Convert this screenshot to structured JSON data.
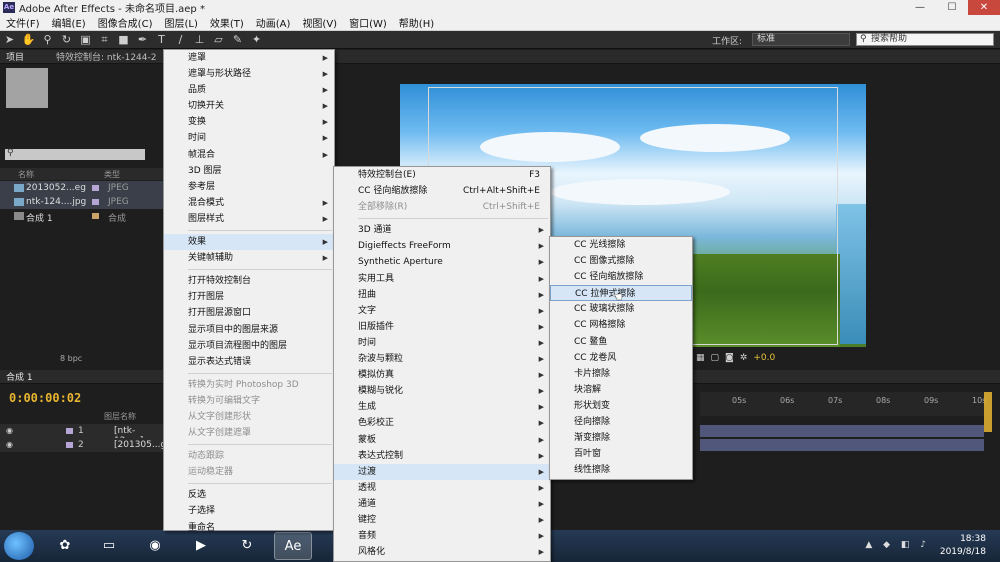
{
  "window": {
    "title": "Adobe After Effects - 未命名项目.aep *",
    "logo": "Ae"
  },
  "menubar": [
    "文件(F)",
    "编辑(E)",
    "图像合成(C)",
    "图层(L)",
    "效果(T)",
    "动画(A)",
    "视图(V)",
    "窗口(W)",
    "帮助(H)"
  ],
  "toolbar": {
    "workspace_label": "工作区:",
    "workspace_value": "标准",
    "help_placeholder": "搜索帮助"
  },
  "panels": {
    "project_tab": "项目",
    "effect_controls_tab": "特效控制台: ntk-1244-2",
    "comp_tab_fragment": "成 1",
    "project_header_name": "名称",
    "project_header_type": "类型",
    "project_items": [
      {
        "name": "2013052...eg",
        "type": "JPEG"
      },
      {
        "name": "ntk-124....jpg",
        "type": "JPEG"
      },
      {
        "name": "合成 1",
        "type": "合成"
      }
    ],
    "bpc": "8 bpc",
    "viewer_offset": "+0.0"
  },
  "timeline": {
    "tab": "合成 1",
    "timecode": "0:00:00:02",
    "header_name": "图层名称",
    "layers": [
      {
        "num": "1",
        "name": "[ntk-12...g]"
      },
      {
        "num": "2",
        "name": "[201305...g]"
      }
    ],
    "ruler": [
      "05s",
      "06s",
      "07s",
      "08s",
      "09s",
      "10s"
    ]
  },
  "layer_menu": {
    "items": [
      {
        "label": "遮罩",
        "sub": true
      },
      {
        "label": "遮罩与形状路径",
        "sub": true
      },
      {
        "label": "品质",
        "sub": true
      },
      {
        "label": "切换开关",
        "sub": true
      },
      {
        "label": "变换",
        "sub": true
      },
      {
        "label": "时间",
        "sub": true
      },
      {
        "label": "帧混合",
        "sub": true
      },
      {
        "label": "3D 图层",
        "sub": false
      },
      {
        "label": "参考层",
        "sub": false
      },
      {
        "label": "混合模式",
        "sub": true
      },
      {
        "label": "图层样式",
        "sub": true
      },
      {
        "sep": true
      },
      {
        "label": "效果",
        "sub": true,
        "hi": true
      },
      {
        "label": "关键帧辅助",
        "sub": true
      },
      {
        "sep": true
      },
      {
        "label": "打开特效控制台",
        "sub": false
      },
      {
        "label": "打开图层",
        "sub": false
      },
      {
        "label": "打开图层源窗口",
        "sub": false
      },
      {
        "label": "显示项目中的图层来源",
        "sub": false
      },
      {
        "label": "显示项目流程图中的图层",
        "sub": false
      },
      {
        "label": "显示表达式错误",
        "sub": false
      },
      {
        "sep": true
      },
      {
        "label": "转换为实时 Photoshop 3D",
        "dis": true
      },
      {
        "label": "转换为可编辑文字",
        "dis": true
      },
      {
        "label": "从文字创建形状",
        "dis": true
      },
      {
        "label": "从文字创建遮罩",
        "dis": true
      },
      {
        "sep": true
      },
      {
        "label": "动态跟踪",
        "dis": true
      },
      {
        "label": "运动稳定器",
        "dis": true
      },
      {
        "sep": true
      },
      {
        "label": "反选",
        "sub": false
      },
      {
        "label": "子选择",
        "sub": false
      },
      {
        "label": "重命名",
        "sub": false
      }
    ]
  },
  "effect_menu": {
    "items": [
      {
        "label": "特效控制台(E)",
        "shortcut": "F3"
      },
      {
        "label": "CC 径向缩放擦除",
        "shortcut": "Ctrl+Alt+Shift+E"
      },
      {
        "label": "全部移除(R)",
        "shortcut": "Ctrl+Shift+E",
        "dis": true
      },
      {
        "sep": true
      },
      {
        "label": "3D 通道",
        "sub": true
      },
      {
        "label": "Digieffects FreeForm",
        "sub": true
      },
      {
        "label": "Synthetic Aperture",
        "sub": true
      },
      {
        "label": "实用工具",
        "sub": true
      },
      {
        "label": "扭曲",
        "sub": true
      },
      {
        "label": "文字",
        "sub": true
      },
      {
        "label": "旧版插件",
        "sub": true
      },
      {
        "label": "时间",
        "sub": true
      },
      {
        "label": "杂波与颗粒",
        "sub": true
      },
      {
        "label": "模拟仿真",
        "sub": true
      },
      {
        "label": "模糊与锐化",
        "sub": true
      },
      {
        "label": "生成",
        "sub": true
      },
      {
        "label": "色彩校正",
        "sub": true
      },
      {
        "label": "蒙板",
        "sub": true
      },
      {
        "label": "表达式控制",
        "sub": true
      },
      {
        "label": "过渡",
        "sub": true,
        "hi": true
      },
      {
        "label": "透视",
        "sub": true
      },
      {
        "label": "通道",
        "sub": true
      },
      {
        "label": "键控",
        "sub": true
      },
      {
        "label": "音频",
        "sub": true
      },
      {
        "label": "风格化",
        "sub": true
      }
    ]
  },
  "transition_menu": {
    "items": [
      {
        "label": "CC 光线擦除"
      },
      {
        "label": "CC 图像式擦除"
      },
      {
        "label": "CC 径向缩放擦除"
      },
      {
        "label": "CC 拉伸式擦除",
        "hi": true
      },
      {
        "label": "CC 玻璃状擦除"
      },
      {
        "label": "CC 网格擦除"
      },
      {
        "label": "CC 鳌鱼"
      },
      {
        "label": "CC 龙卷风"
      },
      {
        "label": "卡片擦除"
      },
      {
        "label": "块溶解"
      },
      {
        "label": "形状划变"
      },
      {
        "label": "径向擦除"
      },
      {
        "label": "渐变擦除"
      },
      {
        "label": "百叶窗"
      },
      {
        "label": "线性擦除"
      }
    ]
  },
  "taskbar": {
    "apps": [
      "folder",
      "firefox",
      "media",
      "refresh",
      "Ae"
    ],
    "time": "18:38",
    "date": "2019/8/18"
  },
  "colors": {
    "timecode": "#e8b531",
    "menu_bg": "#f0f0f0",
    "menu_highlight": "#d6e6f7",
    "layer_track": "#51577a"
  }
}
